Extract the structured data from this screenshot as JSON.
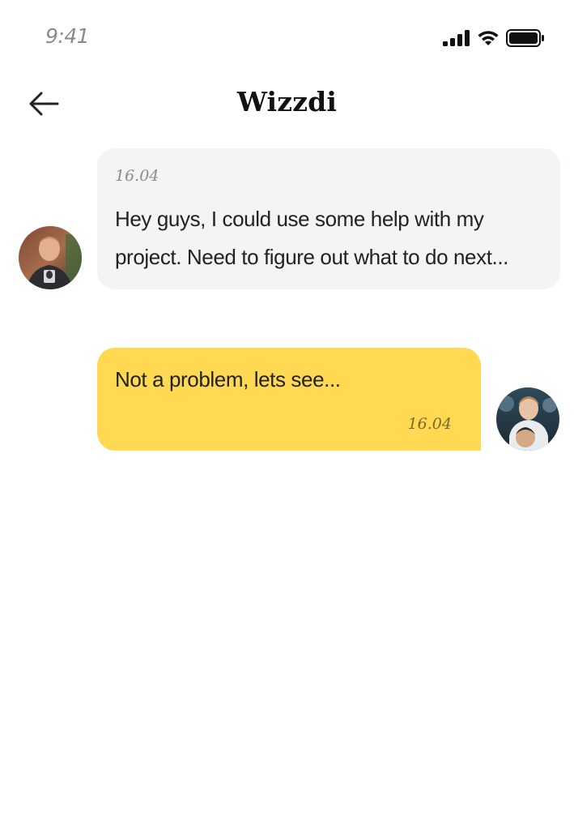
{
  "status_bar": {
    "time": "9:41",
    "icons": [
      "signal-icon",
      "wifi-icon",
      "battery-icon"
    ]
  },
  "header": {
    "back_icon": "arrow-left-icon",
    "title": "Wizzdi"
  },
  "messages": [
    {
      "direction": "incoming",
      "time": "16.04",
      "text": "Hey guys, I could use some help with my project. Need to figure out what to do next...",
      "avatar": "avatar-user-1"
    },
    {
      "direction": "outgoing",
      "time": "16.04",
      "text": "Not a problem, lets see...",
      "avatar": "avatar-user-2"
    }
  ],
  "colors": {
    "incoming_bubble": "#f3f4f6",
    "outgoing_bubble": "#ffd952",
    "title": "#121212",
    "timestamp": "#8c8c8c"
  }
}
